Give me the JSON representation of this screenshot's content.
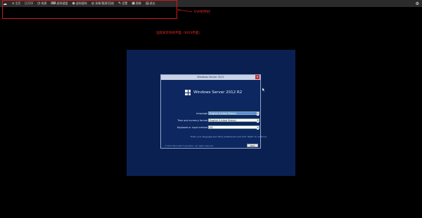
{
  "toolbar": {
    "items": [
      {
        "icon": "home-icon",
        "glyph": "⌂",
        "label": "主页"
      },
      {
        "icon": "screen-icon",
        "glyph": "▯",
        "label": "打印"
      },
      {
        "icon": "clock-icon",
        "glyph": "◷",
        "label": "电源"
      },
      {
        "icon": "keyboard-icon",
        "glyph": "⌨",
        "label": "虚拟键盘"
      },
      {
        "icon": "disk-icon",
        "glyph": "◉",
        "label": "虚拟媒体"
      },
      {
        "icon": "record-icon",
        "glyph": "◎",
        "label": "录像/截屏/回放"
      },
      {
        "icon": "pencil-icon",
        "glyph": "✎",
        "label": "设置"
      },
      {
        "icon": "monitor-icon",
        "glyph": "▣",
        "label": "图像"
      },
      {
        "icon": "file-icon",
        "glyph": "▤",
        "label": "退出"
      }
    ],
    "right_icon": "settings-icon",
    "right_glyph": "⚙"
  },
  "annotation": {
    "label": "KVM控制栏",
    "center_text": "远程安装系统界面（BIOS界面）"
  },
  "dialog": {
    "title": "Windows Server 2012",
    "close": "×",
    "brand": "Windows Server 2012 R2",
    "fields": [
      {
        "label": "Language",
        "value": "English (United States)",
        "selected": true
      },
      {
        "label": "Time and currency format",
        "value": "English (United States)",
        "selected": false
      },
      {
        "label": "Keyboard or input method",
        "value": "US",
        "selected": false
      }
    ],
    "link": "Enter your language and other preferences and click \"Next\" to continue.",
    "footer": "© 2013 Microsoft Corporation. All rights reserved.",
    "next_button": "Next"
  },
  "colors": {
    "toolbar_bg": "#2b2b2b",
    "annotation": "#d01818",
    "console_bg": "#0a2050",
    "dialog_bg": "#0d2760",
    "selected_field": "#5b8fd6"
  }
}
